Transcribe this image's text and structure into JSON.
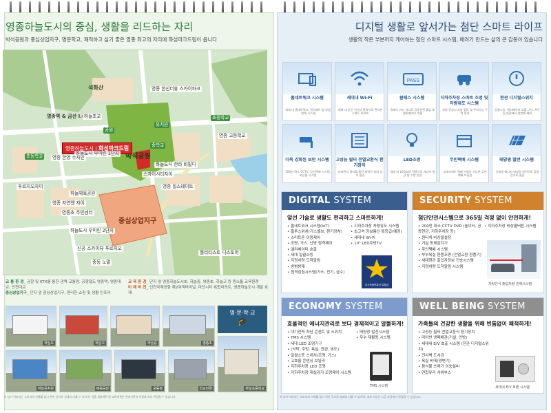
{
  "left": {
    "title": "영종하늘도시의 중심, 생활을 리드하는 자리",
    "subtitle": "박석공원과 중심상업지구, 명문학교, 쾌적하고 살기 좋은 영종 최고의 자리에 화성파크드림이 옵니다",
    "map_labels": {
      "mountain": "석화산",
      "ic": "영종역 & 금산 I.C",
      "park": "박석공원",
      "center": "중심상업지구",
      "callout_prefix": "영종하늘도시 |",
      "callout_name": "화성파크드림",
      "pins": [
        "영종 한신더휴 스카이파크",
        "하늘초교",
        "초등학교",
        "영종 고등학교",
        "유치원",
        "하늘도시 우미린 1단지",
        "초등학교",
        "영종 한양 수자인",
        "스카이시티자이",
        "하늘도시 한라 비발디",
        "영종 힐스테이트",
        "푸르지오자이",
        "영종 자연앤 자이",
        "하늘체육공원",
        "영종초 주민센터",
        "하늘도시 우미린 2단지",
        "신공 스카이뷰 푸르지오",
        "중등 노말",
        "퀄리티스트 디스토어",
        "공원",
        "중학교"
      ]
    },
    "info": {
      "traffic_key": "교 통 환 경",
      "traffic_text": "_ 공항 및 KTX를 통한 광역 교통망, 공항철도 영종역, 영종대교, 인천대교",
      "living_key": "중심상업지구",
      "living_text": "_ 단지 앞 중심상업지구, 편리한 쇼핑 및 생활 인프라",
      "env_key": "교 육 환 경",
      "env_text": "_ 단지 앞 영종하늘도시초, 하늘중, 영종초, 하늘고 등 원스톱 교육환경",
      "future_key": "미 래 비 전",
      "future_text": "_ 인천국제공항 제2여객터미널, 미단시티 복합리조트, 영종하늘도시 개발 호재"
    },
    "school_badge": "명·문·학·교",
    "photo_labels": [
      "하늘초",
      "하늘고",
      "하늘중",
      "영종초",
      "하늘유치원",
      "체육공원",
      "운동장",
      "학교전경",
      "하늘초등학교"
    ],
    "footnote": "※ 상기 이미지는 소비자의 이해를 돕기 위한 것으로 실제와 다를 수 있으며, 각종 개발계획 및 교통계획은 관계기관의 사정에 따라 변경될 수 있습니다."
  },
  "right": {
    "title": "디지털 생활로 앞서가는 첨단 스마트 라이프",
    "subtitle": "생활의 작은 부분까지 케어하는 첨단 스마트 시스템, 배려가 만드는 삶의 큰 감동이 있습니다",
    "grid": [
      {
        "name": "홈네트워크 시스템",
        "desc": "세대 내 홈네트워크, 원격제어 및 방범·방재 시스템",
        "icon": "home-network-icon"
      },
      {
        "name": "세대내 Wi-Fi",
        "desc": "세대 내 무선 인터넷 환경으로 편리한 스마트 라이프",
        "icon": "wifi-icon"
      },
      {
        "name": "원패스 시스템",
        "desc": "원패스 카드 하나로 공동현관 출입 및 엘리베이터 호출",
        "icon": "pass-card-icon"
      },
      {
        "name": "지하주차장 스마트 조명 및 차량유도 시스템",
        "desc": "차량 진입시 자동 점등 및 주차가능 구역 안내",
        "icon": "parking-light-icon"
      },
      {
        "name": "현관 디지털스위치",
        "desc": "일괄소등, 엘리베이터 호출, 가스 차단 등 현관에서 한번에 제어",
        "icon": "switch-icon"
      },
      {
        "name": "더욱 강화된 보안 시스템",
        "desc": "100만 화소 CCTV, 무인택배 시스템, 비상콜 시스템",
        "icon": "cctv-icon"
      },
      {
        "name": "고성능 필터 전열교환식 환기장치",
        "desc": "미세먼지 필터를 통한 쾌적한 실내 공기 환경",
        "icon": "ventilation-icon"
      },
      {
        "name": "LED조명",
        "desc": "세대 내 LED조명 적용으로 에너지 절감 및 수명 연장",
        "icon": "led-bulb-icon"
      },
      {
        "name": "무인택배 시스템",
        "desc": "부재시에도 택배 수령이 가능한 무인택배 보관함",
        "icon": "delivery-box-icon"
      },
      {
        "name": "태양광 발전 시스템",
        "desc": "신재생 에너지 태양광 발전으로 공용 전기료 절감",
        "icon": "solar-panel-icon"
      }
    ],
    "digital": {
      "head_bold": "DIGITAL",
      "head_thin": " SYSTEM",
      "tagline": "앞선 기술로 생활도 편리하고 스마트하게!",
      "list1": [
        "홈네트워크 시스템(IoT)",
        "홈투스위치(가스밸브, 환기장치)",
        "스마트폰 이용제어",
        "조명, 가스, 난방 원격제어",
        "엘리베이터 호출",
        "세대 일괄소등",
        "지정차량 도착알림",
        "방범방재",
        "원격검침시스템(가스, 전기, 급수)"
      ],
      "list2": [
        "지하주차장 차량유도 시스템",
        "초고속 정보통신 특등급(예정)",
        "세대내 Wi-Fi",
        "10\" LED주방TV"
      ],
      "badge": "초고속정보통신 특등급"
    },
    "security": {
      "head_bold": "SECURITY",
      "head_thin": " SYSTEM",
      "tagline": "첨단안전시스템으로 365일 걱정 없이 안전하게!",
      "list1": [
        "200만 화소 CCTV DVR (놀이터, 공동현관, 지하주차장 등)",
        "원터치 비상콜설정",
        "거실 동체감지기",
        "무인택배 시스템",
        "부부욕실 환풍조명 (전열교환 환풍기)",
        "세대현관 출입자정보 전송시스템",
        "지정차량 도착알림 시스템"
      ],
      "list2": [
        "지하주차장 비상콜버튼 시스템"
      ],
      "fig_caption": "차량인식 출입차량 관제시스템"
    },
    "economy": {
      "head_bold": "ECONOMY",
      "head_thin": " SYSTEM",
      "tagline": "효율적인 에너지관리로 보다 경제적이고 알뜰하게!",
      "list1": [
        "대기전력 차단 콘센트 및 스위치",
        "TMS 시스템",
        "세대 LED 조명기구",
        "(식탁, 주방, 욕실, 현관, 복도)",
        "일괄소등 스위치(조명, 가스)",
        "고효율 콘덴싱 보일러",
        "지하주차장 LED 조명",
        "지하주차장 재실감지 조명제어 시스템"
      ],
      "list2": [
        "태양광 발전시스템",
        "우수 재활용 시스템"
      ],
      "fig_caption": "TMS 시스템"
    },
    "wellbeing": {
      "head_bold": "WELL BEING",
      "head_thin": " SYSTEM",
      "tagline": "가족들의 건강한 생활을 위해 빈틈없이 쾌적하게!",
      "list1": [
        "고성능 필터 전열교환식 환기장치",
        "미어번 냉매배관(거실, 안방)",
        "세대내 E/V 호출 시스템 (현관 디지털스위치)",
        "진사벽 도서관",
        "욕실 비데(양변기)",
        "음식물 쓰레기 이송설비",
        "연합유리 샤워부스"
      ],
      "fig_caption": "세대내 E/V 호출 시스템"
    },
    "footnote": "※ 상기 이미지는 소비자의 이해를 돕기 위한 것으로 실제와 다를 수 있으며, 세부 사양은 시공 과정에서 변경될 수 있습니다."
  },
  "colors": {
    "left_title": "#2c7a3a",
    "right_title": "#2b4a6e",
    "digital": "#3a5f8f",
    "security": "#d0822c",
    "economy": "#7d9ccd",
    "wellbeing": "#8f8f8f"
  }
}
